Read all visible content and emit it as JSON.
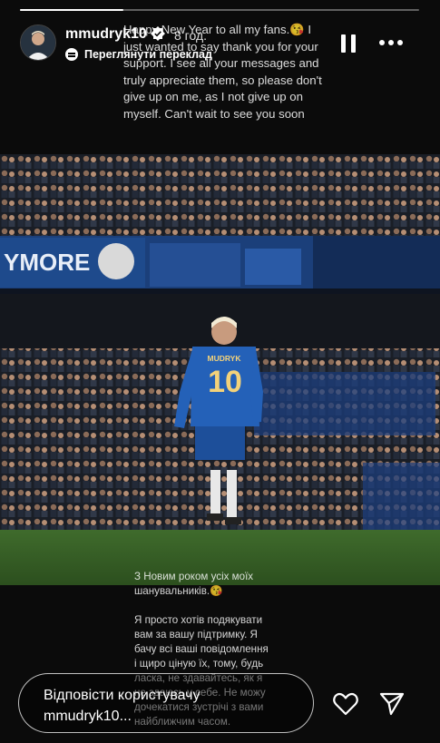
{
  "story": {
    "progress": 0.26,
    "username": "mmudryk10",
    "verified": true,
    "time_ago": "8 год.",
    "translate_label": "Переглянути переклад"
  },
  "caption": {
    "top_text": "Happy New Year to all my fans.😘 I just wanted to say thank you for your support. I see all your messages and truly appreciate them, so please don't give up on me, as I not  give up on myself. Can't wait to see you soon",
    "bottom_p1": "З Новим роком усіх моїх шанувальників.😘",
    "bottom_p2": "Я просто хотів подякувати вам за вашу підтримку. Я бачу всі ваші повідомлення і щиро ціную їх, тому, будь ласка, не здавайтесь, як я не здаюсь у себе. Не можу дочекатися зустрічі з вами найближчим часом."
  },
  "photo": {
    "banner_text": "YMORE",
    "jersey_name": "MUDRYK",
    "jersey_number": "10"
  },
  "footer": {
    "reply_line1": "Відповісти користувачу",
    "reply_line2": "mmudryk10..."
  },
  "icons": {
    "heart": "heart-icon",
    "send": "send-icon",
    "pause": "pause-icon",
    "more": "more-icon"
  }
}
